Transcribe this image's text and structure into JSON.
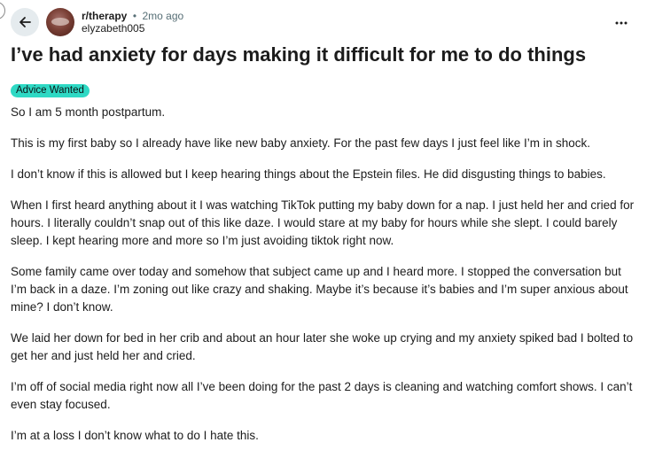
{
  "post": {
    "subreddit": "r/therapy",
    "separator": "•",
    "time": "2mo ago",
    "author": "elyzabeth005",
    "title": "I’ve had anxiety for days making it difficult for me to do things",
    "flair": "Advice Wanted",
    "flair_color": "#2ed9c4",
    "paragraphs": [
      "So I am 5 month postpartum.",
      "This is my first baby so I already have like new baby anxiety. For the past few days I just feel like I’m in shock.",
      "I don’t know if this is allowed but I keep hearing things about the Epstein files. He did disgusting things to babies.",
      "When I first heard anything about it I was watching TikTok putting my baby down for a nap. I just held her and cried for hours. I literally couldn’t snap out of this like daze. I would stare at my baby for hours while she slept. I could barely sleep. I kept hearing more and more so I’m just avoiding tiktok right now.",
      "Some family came over today and somehow that subject came up and I heard more. I stopped the conversation but I’m back in a daze. I’m zoning out like crazy and shaking. Maybe it’s because it’s babies and I’m super anxious about mine? I don’t know.",
      "We laid her down for bed in her crib and about an hour later she woke up crying and my anxiety spiked bad I bolted to get her and just held her and cried.",
      "I’m off of social media right now all I’ve been doing for the past 2 days is cleaning and watching comfort shows. I can’t even stay focused.",
      "I’m at a loss I don’t know what to do I hate this."
    ]
  },
  "icons": {
    "back": "arrow-left-icon",
    "more": "ellipsis-horizontal-icon",
    "avatar": "user-avatar"
  }
}
